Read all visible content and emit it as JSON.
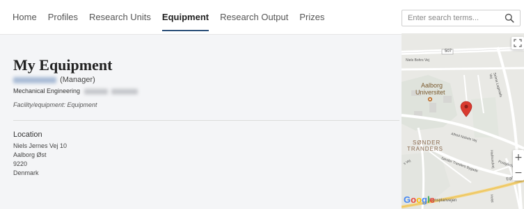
{
  "nav": {
    "items": [
      {
        "label": "Home",
        "active": false
      },
      {
        "label": "Profiles",
        "active": false
      },
      {
        "label": "Research Units",
        "active": false
      },
      {
        "label": "Equipment",
        "active": true
      },
      {
        "label": "Research Output",
        "active": false
      },
      {
        "label": "Prizes",
        "active": false
      }
    ],
    "accent_color": "#2a4f78"
  },
  "search": {
    "placeholder": "Enter search terms...",
    "icon": "search-icon"
  },
  "equipment": {
    "title": "My Equipment",
    "manager_role": "(Manager)",
    "department": "Mechanical Engineering",
    "facility_type": "Facility/equipment: Equipment"
  },
  "location": {
    "heading": "Location",
    "street": "Niels Jernes Vej 10",
    "city": "Aalborg Øst",
    "postcode": "9220",
    "country": "Denmark"
  },
  "map": {
    "labels": {
      "road_number": "507",
      "street_top": "Niels Bohrs Vej",
      "university_line1": "Aalborg",
      "university_line2": "Universitet",
      "selma": "Selma Lagerløfs Vej",
      "alfred": "Alfred Nobels Vej",
      "district_line1": "SØNDER",
      "district_line2": "TRANDERS",
      "bygade": "Sønder Tranders Bygade",
      "hadsund": "Hadsundvej",
      "postgard": "Postgårdsv",
      "egnsp": "Egnspl",
      "bottom_road": "Egnsplanvejen",
      "vej_left": "s Vej",
      "holst": "Holst"
    },
    "zoom_in": "+",
    "zoom_out": "−",
    "attribution": "Google",
    "pin_color": "#d93a2f"
  }
}
